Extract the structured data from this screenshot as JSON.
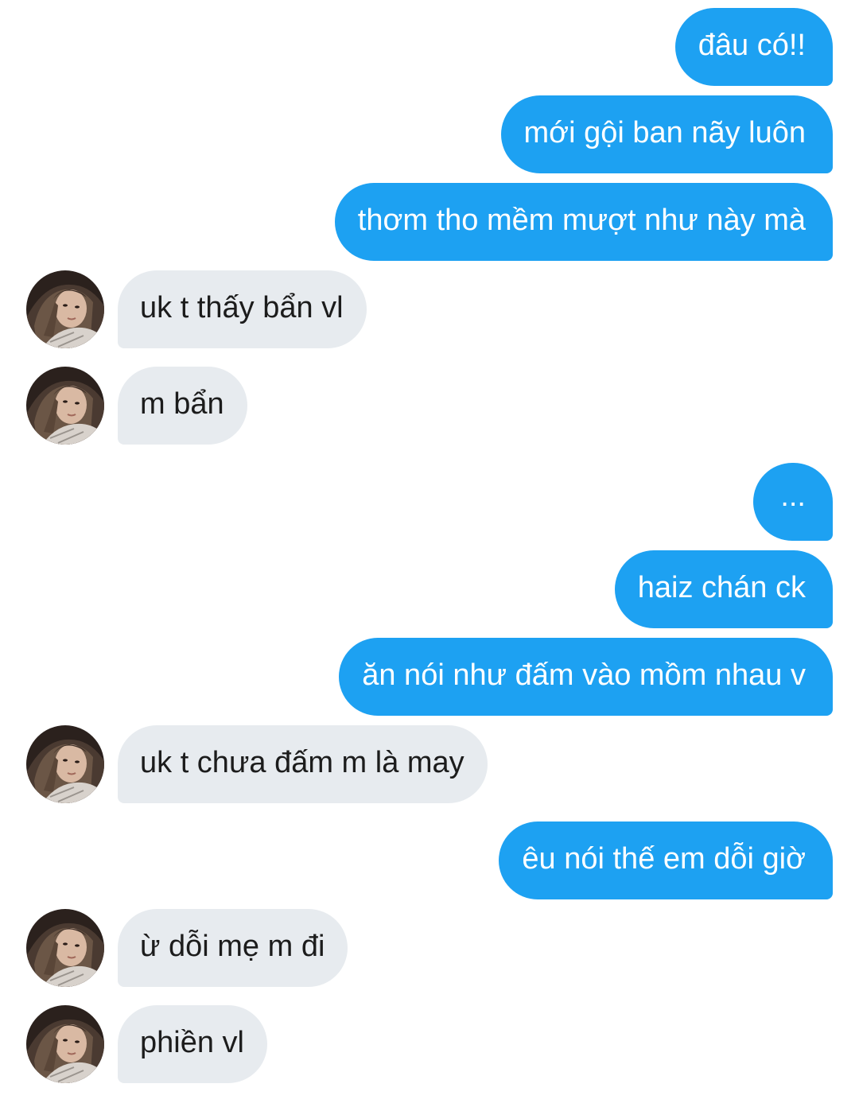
{
  "conversation": {
    "messages": [
      {
        "side": "sent",
        "text": "đâu có!!"
      },
      {
        "side": "sent",
        "text": "mới gội ban nãy luôn"
      },
      {
        "side": "sent",
        "text": "thơm tho mềm mượt như này mà"
      },
      {
        "side": "received",
        "text": "uk t thấy bẩn vl"
      },
      {
        "side": "received",
        "text": "m bẩn"
      },
      {
        "side": "sent",
        "text": "..."
      },
      {
        "side": "sent",
        "text": "haiz chán ck"
      },
      {
        "side": "sent",
        "text": "ăn nói như đấm vào mồm nhau v"
      },
      {
        "side": "received",
        "text": "uk t chưa đấm m là may"
      },
      {
        "side": "sent",
        "text": "êu nói thế em dỗi giờ"
      },
      {
        "side": "received",
        "text": "ừ dỗi mẹ m đi"
      },
      {
        "side": "received",
        "text": "phiền vl"
      }
    ]
  },
  "contact": {
    "avatar_icon": "profile-photo"
  },
  "colors": {
    "sent_bubble": "#1da1f2",
    "received_bubble": "#e7ebef",
    "sent_text": "#ffffff",
    "received_text": "#1c1c1c"
  }
}
